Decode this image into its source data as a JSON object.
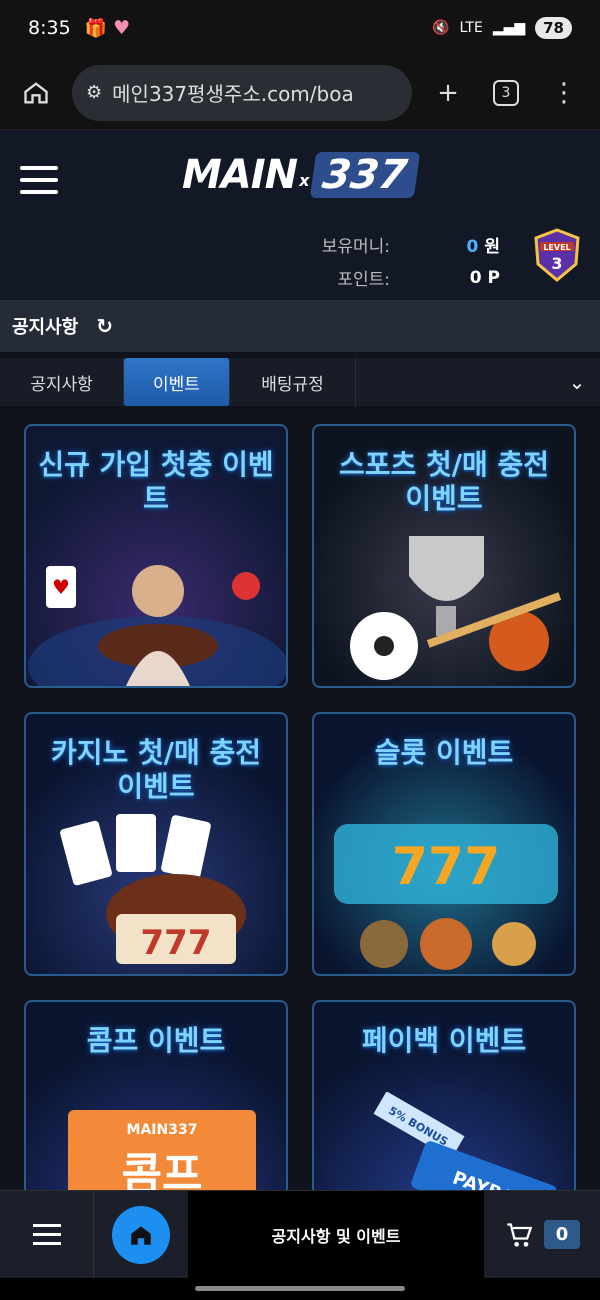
{
  "status": {
    "time": "8:35",
    "network": "LTE",
    "battery": "78"
  },
  "browser": {
    "url": "메인337평생주소.com/boa",
    "tab_count": "3"
  },
  "header": {
    "logo_main": "MAIN",
    "logo_x": "x",
    "logo_num": "337",
    "money_label": "보유머니:",
    "money_value": "0",
    "money_unit": "원",
    "point_label": "포인트:",
    "point_value": "0",
    "point_unit": "P",
    "level_text": "LEVEL",
    "level_num": "3"
  },
  "section": {
    "title": "공지사항"
  },
  "tabs": [
    {
      "label": "공지사항"
    },
    {
      "label": "이벤트"
    },
    {
      "label": "배팅규정"
    }
  ],
  "cards": [
    {
      "title": "신규 가입 첫충 이벤트"
    },
    {
      "title": "스포츠 첫/매 충전 이벤트"
    },
    {
      "title": "카지노 첫/매 충전 이벤트"
    },
    {
      "title": "슬롯 이벤트"
    },
    {
      "title": "콤프 이벤트",
      "badge": "MAIN337",
      "badge_big": "콤프"
    },
    {
      "title": "페이백 이벤트",
      "ribbon": "5% BONUS",
      "ribbon2": "PAYBA"
    }
  ],
  "bottom_nav": {
    "label": "공지사항 및 이벤트",
    "cart_count": "0"
  },
  "colors": {
    "accent": "#1c8ff0",
    "active_tab": "#2f75c9",
    "title_glow": "#7fd4ff"
  }
}
